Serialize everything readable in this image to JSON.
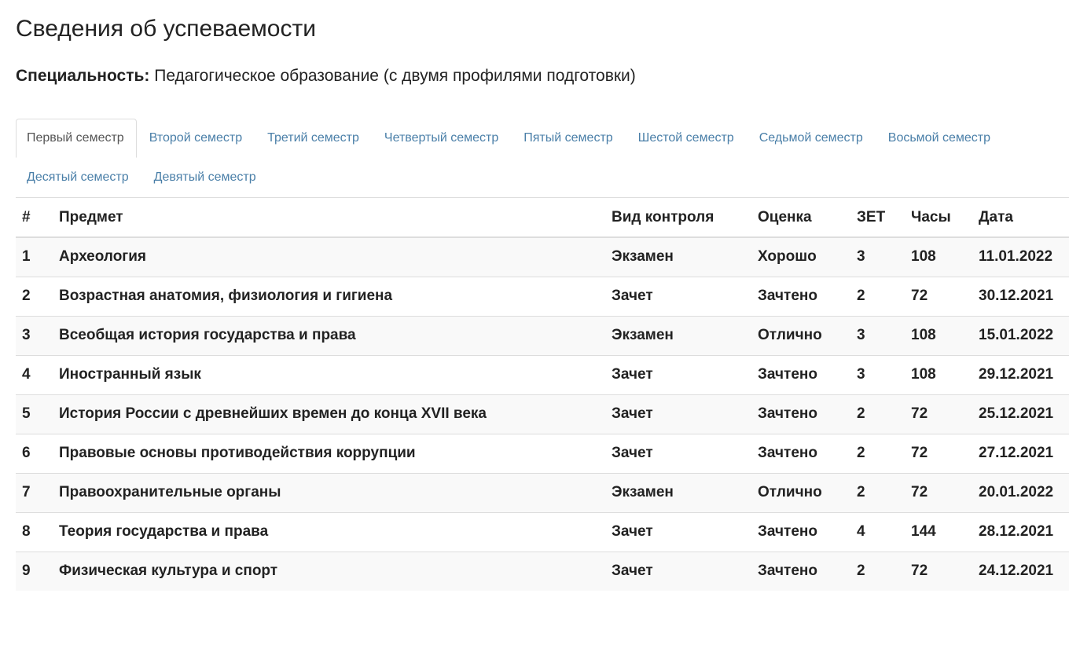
{
  "page_title": "Сведения об успеваемости",
  "specialty": {
    "label": "Специальность:",
    "value": "Педагогическое образование (с двумя профилями подготовки)"
  },
  "tabs": [
    {
      "label": "Первый семестр",
      "active": true
    },
    {
      "label": "Второй семестр",
      "active": false
    },
    {
      "label": "Третий семестр",
      "active": false
    },
    {
      "label": "Четвертый семестр",
      "active": false
    },
    {
      "label": "Пятый семестр",
      "active": false
    },
    {
      "label": "Шестой семестр",
      "active": false
    },
    {
      "label": "Седьмой семестр",
      "active": false
    },
    {
      "label": "Восьмой семестр",
      "active": false
    },
    {
      "label": "Десятый семестр",
      "active": false
    },
    {
      "label": "Девятый семестр",
      "active": false
    }
  ],
  "table": {
    "headers": [
      "#",
      "Предмет",
      "Вид контроля",
      "Оценка",
      "ЗЕТ",
      "Часы",
      "Дата"
    ],
    "rows": [
      [
        "1",
        "Археология",
        "Экзамен",
        "Хорошо",
        "3",
        "108",
        "11.01.2022"
      ],
      [
        "2",
        "Возрастная анатомия, физиология и гигиена",
        "Зачет",
        "Зачтено",
        "2",
        "72",
        "30.12.2021"
      ],
      [
        "3",
        "Всеобщая история государства и права",
        "Экзамен",
        "Отлично",
        "3",
        "108",
        "15.01.2022"
      ],
      [
        "4",
        "Иностранный язык",
        "Зачет",
        "Зачтено",
        "3",
        "108",
        "29.12.2021"
      ],
      [
        "5",
        "История России с древнейших времен до конца XVII века",
        "Зачет",
        "Зачтено",
        "2",
        "72",
        "25.12.2021"
      ],
      [
        "6",
        "Правовые основы противодействия коррупции",
        "Зачет",
        "Зачтено",
        "2",
        "72",
        "27.12.2021"
      ],
      [
        "7",
        "Правоохранительные органы",
        "Экзамен",
        "Отлично",
        "2",
        "72",
        "20.01.2022"
      ],
      [
        "8",
        "Теория государства и права",
        "Зачет",
        "Зачтено",
        "4",
        "144",
        "28.12.2021"
      ],
      [
        "9",
        "Физическая культура и спорт",
        "Зачет",
        "Зачтено",
        "2",
        "72",
        "24.12.2021"
      ]
    ]
  },
  "colors": {
    "link": "#4a7fa8",
    "stripe": "#f9f9f9",
    "border": "#dddddd"
  }
}
